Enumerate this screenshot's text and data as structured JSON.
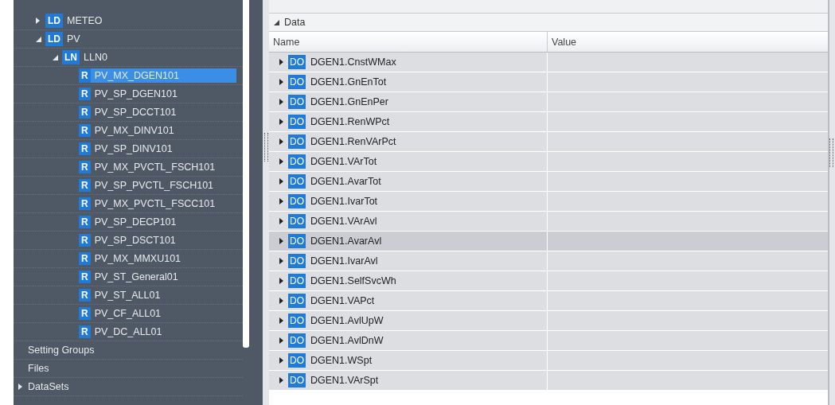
{
  "tree": {
    "nodes": [
      {
        "badge": "LD",
        "label": "METEO",
        "expanded": false
      },
      {
        "badge": "LD",
        "label": "PV",
        "expanded": true,
        "children": [
          {
            "badge": "LN",
            "label": "LLN0",
            "expanded": true,
            "children": [
              {
                "badge": "R",
                "label": "PV_MX_DGEN101",
                "selected": true
              },
              {
                "badge": "R",
                "label": "PV_SP_DGEN101",
                "selected": false
              },
              {
                "badge": "R",
                "label": "PV_SP_DCCT101",
                "selected": false
              },
              {
                "badge": "R",
                "label": "PV_MX_DINV101",
                "selected": false
              },
              {
                "badge": "R",
                "label": "PV_SP_DINV101",
                "selected": false
              },
              {
                "badge": "R",
                "label": "PV_MX_PVCTL_FSCH101",
                "selected": false
              },
              {
                "badge": "R",
                "label": "PV_SP_PVCTL_FSCH101",
                "selected": false
              },
              {
                "badge": "R",
                "label": "PV_MX_PVCTL_FSCC101",
                "selected": false
              },
              {
                "badge": "R",
                "label": "PV_SP_DECP101",
                "selected": false
              },
              {
                "badge": "R",
                "label": "PV_SP_DSCT101",
                "selected": false
              },
              {
                "badge": "R",
                "label": "PV_MX_MMXU101",
                "selected": false
              },
              {
                "badge": "R",
                "label": "PV_ST_General01",
                "selected": false
              },
              {
                "badge": "R",
                "label": "PV_ST_ALL01",
                "selected": false
              },
              {
                "badge": "R",
                "label": "PV_CF_ALL01",
                "selected": false
              },
              {
                "badge": "R",
                "label": "PV_DC_ALL01",
                "selected": false
              }
            ]
          }
        ]
      }
    ],
    "sections": [
      {
        "label": "Setting Groups"
      },
      {
        "label": "Files"
      },
      {
        "label": "DataSets",
        "expanded": false
      }
    ]
  },
  "data": {
    "title": "Data",
    "expanded": true,
    "columns": [
      "Name",
      "Value"
    ],
    "rows": [
      {
        "badge": "DO",
        "name": "DGEN1.CnstWMax",
        "highlighted": false,
        "expanded": false
      },
      {
        "badge": "DO",
        "name": "DGEN1.GnEnTot",
        "highlighted": false,
        "expanded": false
      },
      {
        "badge": "DO",
        "name": "DGEN1.GnEnPer",
        "highlighted": false,
        "expanded": false
      },
      {
        "badge": "DO",
        "name": "DGEN1.RenWPct",
        "highlighted": false,
        "expanded": false
      },
      {
        "badge": "DO",
        "name": "DGEN1.RenVArPct",
        "highlighted": false,
        "expanded": false
      },
      {
        "badge": "DO",
        "name": "DGEN1.VArTot",
        "highlighted": false,
        "expanded": false
      },
      {
        "badge": "DO",
        "name": "DGEN1.AvarTot",
        "highlighted": false,
        "expanded": false
      },
      {
        "badge": "DO",
        "name": "DGEN1.IvarTot",
        "highlighted": false,
        "expanded": false
      },
      {
        "badge": "DO",
        "name": "DGEN1.VArAvl",
        "highlighted": false,
        "expanded": false
      },
      {
        "badge": "DO",
        "name": "DGEN1.AvarAvl",
        "highlighted": true,
        "expanded": false
      },
      {
        "badge": "DO",
        "name": "DGEN1.IvarAvl",
        "highlighted": false,
        "expanded": false
      },
      {
        "badge": "DO",
        "name": "DGEN1.SelfSvcWh",
        "highlighted": false,
        "expanded": false
      },
      {
        "badge": "DO",
        "name": "DGEN1.VAPct",
        "highlighted": false,
        "expanded": false
      },
      {
        "badge": "DO",
        "name": "DGEN1.AvlUpW",
        "highlighted": false,
        "expanded": false
      },
      {
        "badge": "DO",
        "name": "DGEN1.AvlDnW",
        "highlighted": false,
        "expanded": false
      },
      {
        "badge": "DO",
        "name": "DGEN1.WSpt",
        "highlighted": false,
        "expanded": false
      },
      {
        "badge": "DO",
        "name": "DGEN1.VArSpt",
        "highlighted": false,
        "expanded": false
      }
    ]
  }
}
